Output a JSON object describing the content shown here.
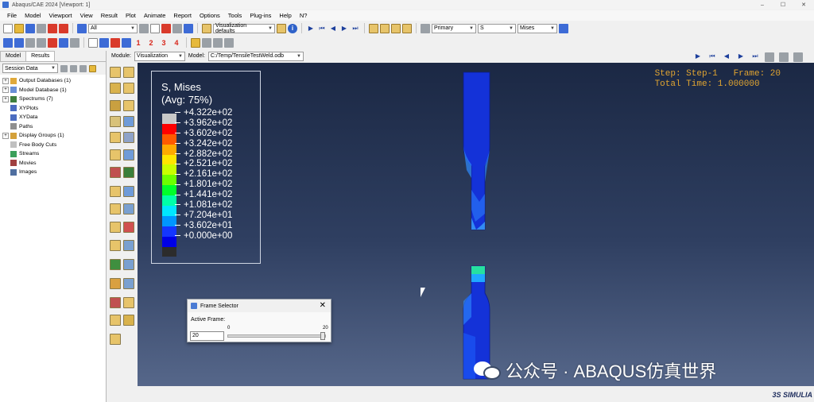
{
  "window": {
    "title": "Abaqus/CAE 2024 [Viewport: 1]",
    "controls": [
      "–",
      "☐",
      "✕"
    ]
  },
  "menu": [
    "File",
    "Model",
    "Viewport",
    "View",
    "Result",
    "Plot",
    "Animate",
    "Report",
    "Options",
    "Tools",
    "Plug-ins",
    "Help",
    "N?"
  ],
  "toolbar": {
    "selection_filter": "All",
    "view_defaults": "Visualization defaults",
    "field_position": "Primary",
    "field_variable": "S",
    "field_invariant": "Mises",
    "number_buttons": [
      "1",
      "2",
      "3",
      "4"
    ]
  },
  "module_bar": {
    "module_label": "Module:",
    "module_value": "Visualization",
    "model_label": "Model:",
    "model_value": "C:/Temp/TensileTestWeld.odb"
  },
  "left_panel": {
    "tabs": [
      "Model",
      "Results"
    ],
    "active_tab": "Results",
    "session_combo": "Session Data",
    "tree": [
      {
        "label": "Output Databases (1)",
        "expandable": true
      },
      {
        "label": "Model Database (1)",
        "expandable": true
      },
      {
        "label": "Spectrums (7)",
        "expandable": true
      },
      {
        "label": "XYPlots",
        "expandable": false
      },
      {
        "label": "XYData",
        "expandable": false
      },
      {
        "label": "Paths",
        "expandable": false
      },
      {
        "label": "Display Groups (1)",
        "expandable": true
      },
      {
        "label": "Free Body Cuts",
        "expandable": false
      },
      {
        "label": "Streams",
        "expandable": false
      },
      {
        "label": "Movies",
        "expandable": false
      },
      {
        "label": "Images",
        "expandable": false
      }
    ]
  },
  "legend": {
    "title": "S, Mises",
    "subtitle": "(Avg: 75%)",
    "levels": [
      "+4.322e+02",
      "+3.962e+02",
      "+3.602e+02",
      "+3.242e+02",
      "+2.882e+02",
      "+2.521e+02",
      "+2.161e+02",
      "+1.801e+02",
      "+1.441e+02",
      "+1.081e+02",
      "+7.204e+01",
      "+3.602e+01",
      "+0.000e+00"
    ],
    "colors": [
      "#c8c8c8",
      "#ff0000",
      "#ff5a00",
      "#ffaa00",
      "#ffe600",
      "#c8ff00",
      "#6cff00",
      "#00ff2a",
      "#00ffa8",
      "#00e6ff",
      "#0096ff",
      "#1436ff",
      "#0000e6",
      "#2c2c2c"
    ]
  },
  "step_info": {
    "line1": "Step: Step-1   Frame: 20",
    "line2": "Total Time: 1.000000"
  },
  "frame_selector": {
    "title": "Frame Selector",
    "active_frame_label": "Active Frame:",
    "value": "20",
    "min": "0",
    "max": "20",
    "fraction": 1.0
  },
  "watermark": "公众号 · ABAQUS仿真世界",
  "brand": "3S SIMULIA"
}
